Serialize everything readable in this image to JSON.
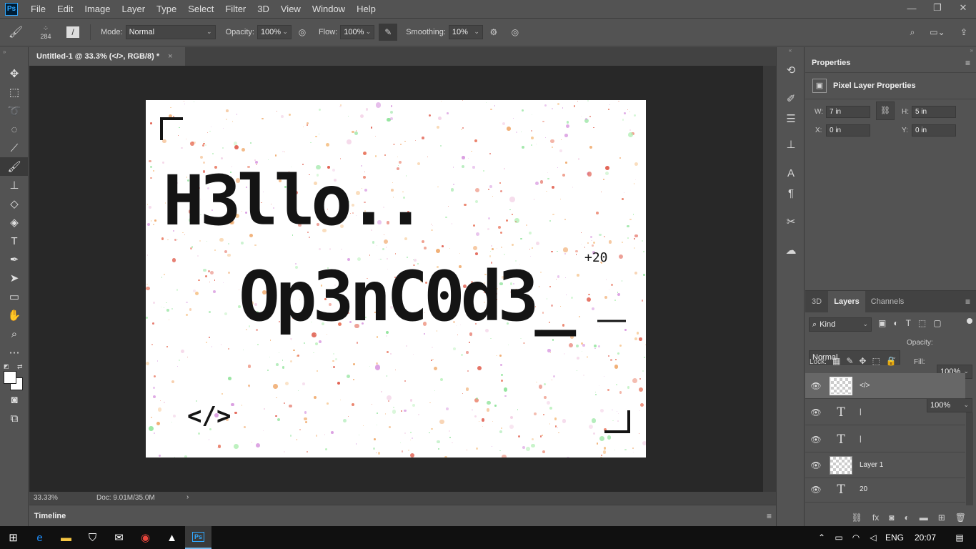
{
  "app": {
    "logo": "Ps"
  },
  "menu": [
    "File",
    "Edit",
    "Image",
    "Layer",
    "Type",
    "Select",
    "Filter",
    "3D",
    "View",
    "Window",
    "Help"
  ],
  "window_controls": {
    "minimize": "—",
    "restore": "❐",
    "close": "✕"
  },
  "options": {
    "brush_size": "284",
    "mode_label": "Mode:",
    "mode_value": "Normal",
    "opacity_label": "Opacity:",
    "opacity_value": "100%",
    "flow_label": "Flow:",
    "flow_value": "100%",
    "smoothing_label": "Smoothing:",
    "smoothing_value": "10%"
  },
  "document": {
    "tab_title": "Untitled-1 @ 33.3% (</>, RGB/8) *",
    "tab_close": "×",
    "zoom": "33.33%",
    "doc_info": "Doc: 9.01M/35.0M",
    "timeline_label": "Timeline"
  },
  "artwork": {
    "line1": "H3llo..",
    "line2": "Op3nC0d3_",
    "superscript": "+20",
    "code_tag": "</>"
  },
  "properties": {
    "panel_title": "Properties",
    "section_title": "Pixel Layer Properties",
    "w_label": "W:",
    "w_value": "7 in",
    "h_label": "H:",
    "h_value": "5 in",
    "x_label": "X:",
    "x_value": "0 in",
    "y_label": "Y:",
    "y_value": "0 in"
  },
  "layers_panel": {
    "tabs": [
      "3D",
      "Layers",
      "Channels"
    ],
    "filter_kind": "Kind",
    "blend_mode": "Normal",
    "opacity_label": "Opacity:",
    "opacity_value": "100%",
    "lock_label": "Lock:",
    "fill_label": "Fill:",
    "fill_value": "100%",
    "layers": [
      {
        "name": "</>",
        "type": "pixel",
        "selected": true
      },
      {
        "name": "|",
        "type": "text"
      },
      {
        "name": "|",
        "type": "text"
      },
      {
        "name": "Layer 1",
        "type": "pixel"
      },
      {
        "name": "20",
        "type": "text"
      }
    ]
  },
  "taskbar": {
    "language": "ENG",
    "time": "20:07"
  },
  "colors": {
    "accent": "#31a8ff",
    "panel": "#535353",
    "canvas_bg": "#282828"
  }
}
